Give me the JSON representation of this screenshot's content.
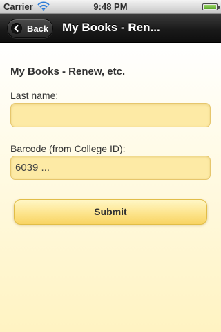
{
  "status_bar": {
    "carrier": "Carrier",
    "time": "9:48 PM",
    "wifi_icon": "wifi-icon",
    "battery_icon": "battery-icon"
  },
  "nav": {
    "back_label": "Back",
    "back_icon": "chevron-left-icon",
    "title": "My Books - Ren..."
  },
  "form": {
    "heading": "My Books - Renew, etc.",
    "last_name_label": "Last name:",
    "last_name_value": "",
    "barcode_label": "Barcode (from College ID):",
    "barcode_placeholder": "6039 ...",
    "submit_label": "Submit"
  },
  "colors": {
    "nav_bar": "#1a1a1a",
    "field_fill": "#fdeaa5",
    "field_border": "#e6c66d",
    "button_fill": "#fde48d"
  }
}
